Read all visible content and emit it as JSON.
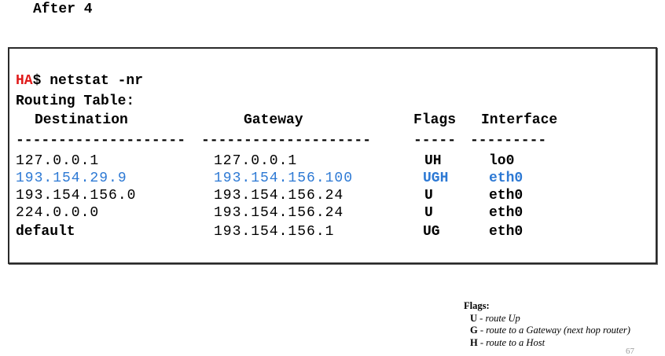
{
  "heading": "After 4",
  "terminal": {
    "prompt_host": "HA",
    "prompt_rest": "$ netstat -nr",
    "table_title": "Routing Table:",
    "columns": {
      "destination": "Destination",
      "gateway": "Gateway",
      "flags": "Flags",
      "interface": "Interface"
    },
    "separators": {
      "destination": "--------------------",
      "gateway": "--------------------",
      "flags": "-----",
      "interface": "---------"
    },
    "rows": [
      {
        "destination": "127.0.0.1",
        "gateway": "127.0.0.1",
        "flags": "UH",
        "interface": "lo0",
        "highlight": false
      },
      {
        "destination": "193.154.29.9",
        "gateway": "193.154.156.100",
        "flags": "UGH",
        "interface": "eth0",
        "highlight": true
      },
      {
        "destination": "193.154.156.0",
        "gateway": "193.154.156.24",
        "flags": "U",
        "interface": "eth0",
        "highlight": false
      },
      {
        "destination": "224.0.0.0",
        "gateway": "193.154.156.24",
        "flags": "U",
        "interface": "eth0",
        "highlight": false
      },
      {
        "destination": "default",
        "gateway": "193.154.156.1",
        "flags": "UG",
        "interface": "eth0",
        "highlight": false
      }
    ],
    "highlight_color": "#2d79d4",
    "prompt_host_color": "#e01b1b"
  },
  "legend": {
    "title": "Flags:",
    "items": [
      {
        "key": "U",
        "desc": "route Up"
      },
      {
        "key": "G",
        "desc": "route to a Gateway (next hop router)"
      },
      {
        "key": "H",
        "desc": "route to a Host"
      }
    ]
  },
  "page_number": "67"
}
